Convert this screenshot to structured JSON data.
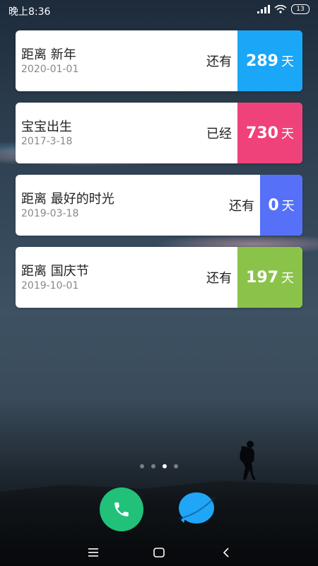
{
  "status_bar": {
    "time": "晚上8:36",
    "battery": "13"
  },
  "cards": [
    {
      "title": "距离 新年",
      "date": "2020-01-01",
      "prefix": "还有",
      "days": "289",
      "unit": "天",
      "color": "#1aa7f7"
    },
    {
      "title": "宝宝出生",
      "date": "2017-3-18",
      "prefix": "已经",
      "days": "730",
      "unit": "天",
      "color": "#f0427a"
    },
    {
      "title": "距离 最好的时光",
      "date": "2019-03-18",
      "prefix": "还有",
      "days": "0",
      "unit": "天",
      "color": "#5671f7"
    },
    {
      "title": "距离 国庆节",
      "date": "2019-10-01",
      "prefix": "还有",
      "days": "197",
      "unit": "天",
      "color": "#8bc34a"
    }
  ],
  "dock": {
    "phone_color": "#21c17a",
    "messages_color": "#1fa6f7"
  },
  "page_indicator": {
    "count": 4,
    "active_index": 2
  },
  "nav": {
    "menu_icon": "menu-icon",
    "home_icon": "home-icon",
    "back_icon": "back-icon"
  }
}
